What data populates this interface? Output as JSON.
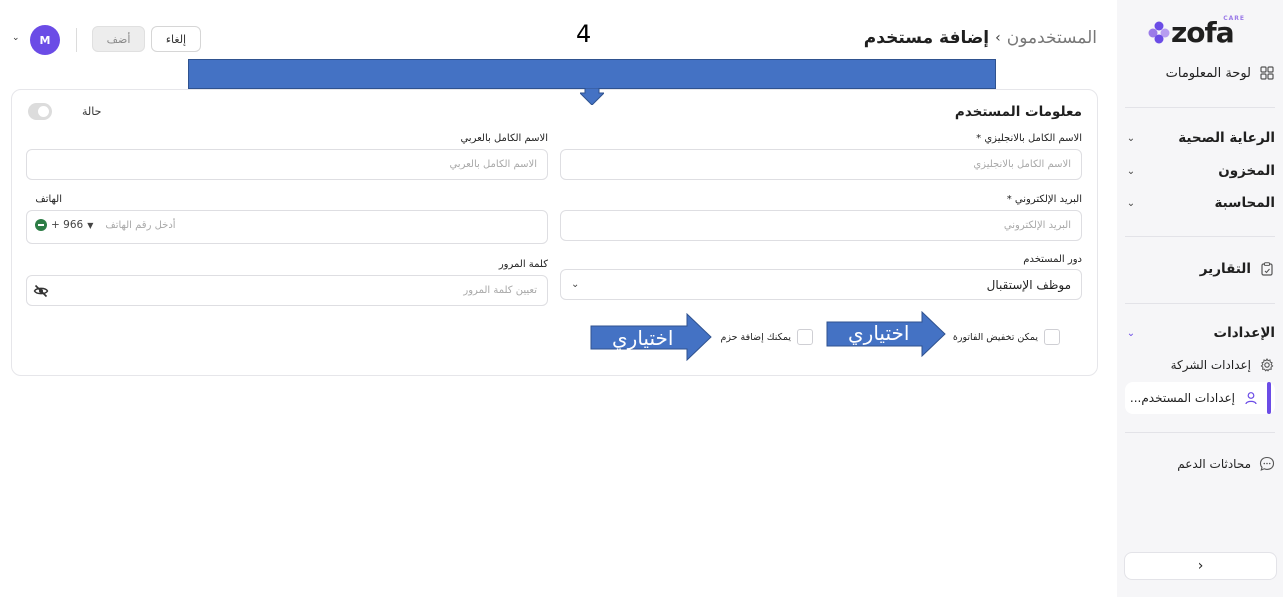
{
  "sidebar": {
    "logo_text": "zofa",
    "logo_badge": "CARE",
    "dashboard": "لوحة المعلومات",
    "sections": [
      {
        "label": "الرعاية الصحية"
      },
      {
        "label": "المخزون"
      },
      {
        "label": "المحاسبة"
      }
    ],
    "reports": "التقارير",
    "settings": "الإعدادات",
    "company_settings": "إعدادات الشركة",
    "user_settings": "إعدادات المستخدم...",
    "support": "محادثات الدعم",
    "collapse": "‹"
  },
  "header": {
    "crumb_parent": "المستخدمون",
    "crumb_sep": "›",
    "crumb_current": "إضافة مستخدم",
    "step_number": "4",
    "add_button": "أضف",
    "cancel_button": "إلغاء",
    "avatar_initial": "M"
  },
  "form": {
    "section_title": "معلومات المستخدم",
    "status_label": "حالة",
    "status_on": false,
    "name_en_label": "الاسم الكامل بالانجليزي *",
    "name_en_placeholder": "الاسم الكامل بالانجليزي",
    "name_ar_label": "الاسم الكامل بالعربي",
    "name_ar_placeholder": "الاسم الكامل بالعربي",
    "email_label": "البريد الإلكتروني *",
    "email_placeholder": "البريد الإلكتروني",
    "phone_label": "الهاتف",
    "phone_placeholder": "أدخل رقم الهاتف",
    "phone_code": "+ 966",
    "role_label": "دور المستخدم",
    "role_value": "موظف الإستقبال",
    "password_label": "كلمة المرور",
    "password_placeholder": "تعيين كلمة المرور",
    "can_discount_invoice": "يمكن تخفيض الفاتورة",
    "can_add_packages": "يمكنك إضافة حزم"
  },
  "annotations": {
    "optional_1": "اختياري",
    "optional_2": "اختياري",
    "overlay_color": "#4472c4"
  },
  "colors": {
    "accent": "#6b4ce6",
    "sidebar_bg": "#f6f6f8"
  }
}
